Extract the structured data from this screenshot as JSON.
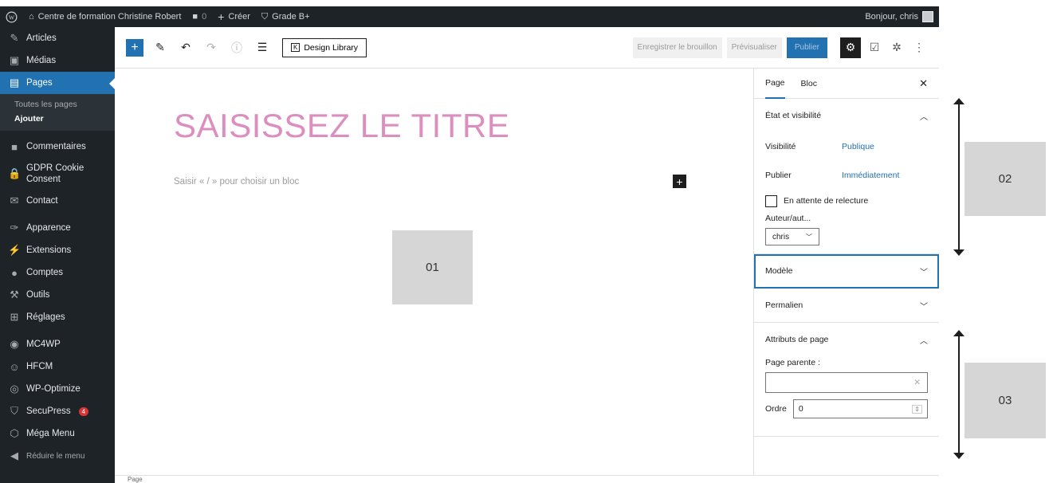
{
  "admin_bar": {
    "site_name": "Centre de formation Christine Robert",
    "comments_count": "0",
    "new_label": "Créer",
    "grade_label": "Grade B+",
    "greeting": "Bonjour, chris"
  },
  "menu": {
    "articles": "Articles",
    "medias": "Médias",
    "pages": "Pages",
    "sub_all_pages": "Toutes les pages",
    "sub_add": "Ajouter",
    "comments": "Commentaires",
    "gdpr": "GDPR Cookie Consent",
    "contact": "Contact",
    "appearance": "Apparence",
    "extensions": "Extensions",
    "accounts": "Comptes",
    "tools": "Outils",
    "settings": "Réglages",
    "mc4wp": "MC4WP",
    "hfcm": "HFCM",
    "wp_optimize": "WP-Optimize",
    "secupress": "SecuPress",
    "secupress_badge": "4",
    "mega_menu": "Méga Menu",
    "collapse": "Réduire le menu"
  },
  "toolbar": {
    "design_library": "Design Library",
    "save_draft": "Enregistrer le brouillon",
    "preview": "Prévisualiser",
    "publish": "Publier"
  },
  "editor": {
    "title_placeholder": "SAISISSEZ LE TITRE",
    "block_placeholder": "Saisir « / » pour choisir un bloc",
    "footer_breadcrumb": "Page"
  },
  "sidebar": {
    "tab_page": "Page",
    "tab_block": "Bloc",
    "status_panel": "État et visibilité",
    "visibility_label": "Visibilité",
    "visibility_value": "Publique",
    "publish_label": "Publier",
    "publish_value": "Immédiatement",
    "pending_review": "En attente de relecture",
    "author_label": "Auteur/aut...",
    "author_value": "chris",
    "template_panel": "Modèle",
    "permalink_panel": "Permalien",
    "attributes_panel": "Attributs de page",
    "parent_label": "Page parente :",
    "order_label": "Ordre",
    "order_value": "0"
  },
  "callouts": {
    "c1": "01",
    "c2": "02",
    "c3": "03"
  },
  "colors": {
    "admin_dark": "#1d2327",
    "accent_blue": "#2271b1",
    "title_pink": "#dc8fbe"
  }
}
